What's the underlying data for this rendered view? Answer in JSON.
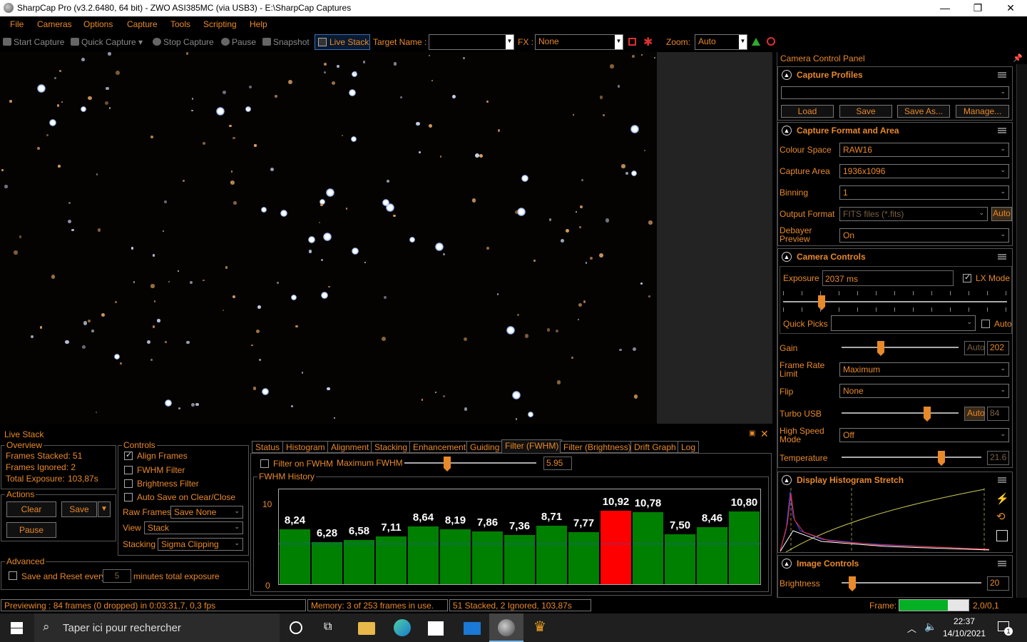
{
  "window": {
    "title": "SharpCap Pro (v3.2.6480, 64 bit) - ZWO ASI385MC (via USB3) - E:\\SharpCap Captures"
  },
  "menu": [
    "File",
    "Cameras",
    "Options",
    "Capture",
    "Tools",
    "Scripting",
    "Help"
  ],
  "toolbar": {
    "start_capture": "Start Capture",
    "quick_capture": "Quick Capture",
    "stop_capture": "Stop Capture",
    "pause": "Pause",
    "snapshot": "Snapshot",
    "live_stack": "Live Stack",
    "target_name_label": "Target Name :",
    "target_name_value": "",
    "fx_label": "FX :",
    "fx_value": "None",
    "zoom_label": "Zoom:",
    "zoom_value": "Auto"
  },
  "camera_panel": {
    "header": "Camera Control Panel",
    "capture_profiles": {
      "title": "Capture Profiles",
      "selected": "",
      "load": "Load",
      "save": "Save",
      "save_as": "Save As...",
      "manage": "Manage..."
    },
    "capture_format": {
      "title": "Capture Format and Area",
      "colour_space_label": "Colour Space",
      "colour_space": "RAW16",
      "capture_area_label": "Capture Area",
      "capture_area": "1936x1096",
      "binning_label": "Binning",
      "binning": "1",
      "output_format_label": "Output Format",
      "output_format": "FITS files (*.fits)",
      "output_auto": "Auto",
      "debayer_label_1": "Debayer",
      "debayer_label_2": "Preview",
      "debayer": "On"
    },
    "camera_controls": {
      "title": "Camera Controls",
      "exposure_label": "Exposure",
      "exposure": "2037 ms",
      "lx_mode": "LX Mode",
      "quick_picks_label": "Quick Picks",
      "quick_picks": "",
      "quick_auto": "Auto",
      "gain_label": "Gain",
      "gain_auto": "Auto",
      "gain": "202",
      "frame_rate_label_1": "Frame Rate",
      "frame_rate_label_2": "Limit",
      "frame_rate": "Maximum",
      "flip_label": "Flip",
      "flip": "None",
      "turbo_label": "Turbo USB",
      "turbo_auto": "Auto",
      "turbo": "84",
      "high_speed_label_1": "High Speed",
      "high_speed_label_2": "Mode",
      "high_speed": "Off",
      "temperature_label": "Temperature",
      "temperature": "21.6"
    },
    "histogram": {
      "title": "Display Histogram Stretch"
    },
    "image_controls": {
      "title": "Image Controls",
      "brightness_label": "Brightness",
      "brightness": "20"
    }
  },
  "live_stack": {
    "title": "Live Stack",
    "overview": {
      "label": "Overview",
      "stacked": "Frames Stacked: 51",
      "ignored": "Frames Ignored:  2",
      "exposure_label": "Total Exposure:",
      "exposure": "103,87s"
    },
    "actions": {
      "label": "Actions",
      "clear": "Clear",
      "save": "Save",
      "pause": "Pause"
    },
    "advanced": {
      "label": "Advanced",
      "save_reset": "Save and Reset every",
      "minutes_value": "5",
      "minutes_label": "minutes total exposure"
    },
    "controls": {
      "label": "Controls",
      "align": "Align Frames",
      "fwhm": "FWHM Filter",
      "brightness": "Brightness Filter",
      "autosave": "Auto Save on Clear/Close",
      "raw_frames_label": "Raw Frames",
      "raw_frames": "Save None",
      "view_label": "View",
      "view": "Stack",
      "stacking_label": "Stacking",
      "stacking": "Sigma Clipping"
    },
    "tabs": [
      "Status",
      "Histogram",
      "Alignment",
      "Stacking",
      "Enhancement",
      "Guiding",
      "Filter (FWHM)",
      "Filter (Brightness)",
      "Drift Graph",
      "Log"
    ],
    "filter": {
      "filter_on": "Filter on FWHM",
      "max_label": "Maximum FWHM",
      "max_value": "5.95",
      "history_label": "FWHM History"
    }
  },
  "chart_data": {
    "type": "bar",
    "title": "FWHM History",
    "ylim": [
      0,
      10
    ],
    "yticks": [
      "10",
      "0"
    ],
    "values": [
      8.24,
      6.28,
      6.58,
      7.11,
      8.64,
      8.19,
      7.86,
      7.36,
      8.71,
      7.77,
      10.92,
      10.78,
      7.5,
      8.46,
      10.8
    ],
    "labels": [
      "8,24",
      "6,28",
      "6,58",
      "7,11",
      "8,64",
      "8,19",
      "7,86",
      "7,36",
      "8,71",
      "7,77",
      "10,92",
      "10,78",
      "7,50",
      "8,46",
      "10,80"
    ],
    "highlighted_index": 10,
    "colors": {
      "normal": "#008000",
      "highlight": "#ff0000"
    }
  },
  "status": {
    "preview": "Previewing : 84 frames (0 dropped) in 0:03:31,7, 0,3 fps",
    "memory": "Memory: 3 of 253 frames in use.",
    "stack": "51 Stacked, 2 Ignored, 103,87s",
    "frame_label": "Frame:",
    "frame_progress": 0.7,
    "frame_value": "2,0/0,1"
  },
  "taskbar": {
    "search_placeholder": "Taper ici pour rechercher",
    "time": "22:37",
    "date": "14/10/2021",
    "notification_count": "1"
  }
}
